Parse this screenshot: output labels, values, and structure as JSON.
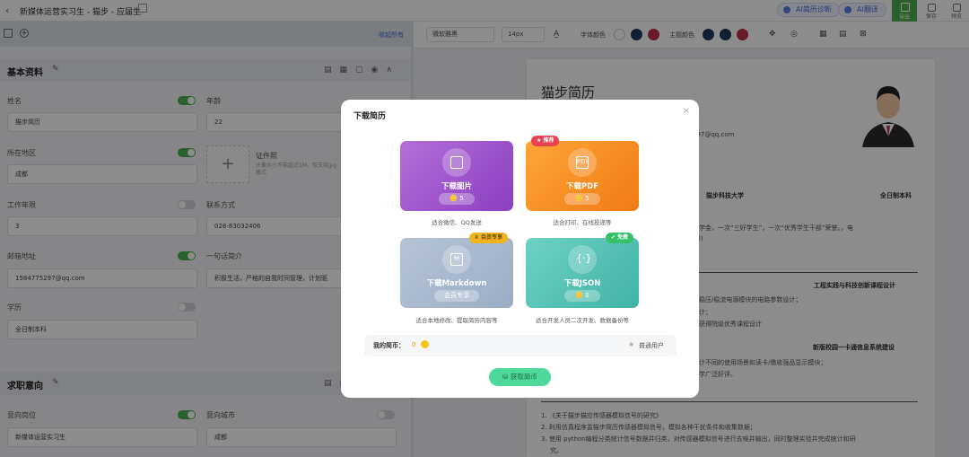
{
  "topbar": {
    "title": "新媒体运营实习生 - 猫步 - 应届生",
    "ai_diagnose": "AI简历诊断",
    "ai_translate": "AI翻译",
    "export": "导出",
    "save": "保存",
    "preview": "预览"
  },
  "left": {
    "collapse_all": "收起所有",
    "basic_section": "基本资料",
    "fields": {
      "name_label": "姓名",
      "name_value": "猫步简历",
      "age_label": "年龄",
      "age_value": "22",
      "location_label": "所在地区",
      "location_value": "成都",
      "photo_label": "证件照",
      "photo_hint": "头像大小不能超过1M，仅支持jpg格式",
      "work_years_label": "工作年限",
      "work_years_value": "3",
      "contact_label": "联系方式",
      "contact_value": "028-83032406",
      "email_label": "邮箱地址",
      "email_value": "1584775297@qq.com",
      "intro_label": "一句话简介",
      "intro_value": "积极生活，严格的自我时间管理，计划驱",
      "edu_label": "学历",
      "edu_value": "全日制本科"
    },
    "intent_section": "求职意向",
    "intent": {
      "position_label": "意向岗位",
      "position_value": "新媒体运营实习生",
      "city_label": "意向城市",
      "city_value": "成都"
    }
  },
  "toolbar": {
    "font": "微软雅黑",
    "size": "14px",
    "font_color_label": "字体颜色",
    "theme_color_label": "主题颜色"
  },
  "resume": {
    "name": "猫步简历",
    "email": "297@qq.com",
    "school": "猫步科技大学",
    "degree": "全日制本科",
    "award": "奖学金，一次“三好学生”，一次“优秀学生干部”荣誉。，电",
    "award2": "18)",
    "proj1_title": "工程实践与科技创新课程设计",
    "proj1_l1": "关稳压/稳流电源模块的电路参数设计；",
    "proj1_l2": "设计；",
    "proj1_l3": "，获得院级优秀课程设计",
    "proj2_title": "新版校园一卡通信息系统建设",
    "proj2_l1": "设计不同的使用场景和读卡/缴收强品显示模块；",
    "proj2_l2": "同学广泛好评。",
    "r1": "1. 《关于猫步猫应传感器模拟信号的研究》",
    "r2": "2. 利用仿真程序监猫步简历传感器模拟信号，模拟各种干扰条件和收集数据；",
    "r3": "3. 使用 python编程分类统计信号数据并归类，对传感器模拟信号进行去噪并输出，同时整理实验并完成统计和研",
    "r4": "究。"
  },
  "colors": {
    "font_colors": [
      "#ffffff",
      "#1f3a5f",
      "#c0304a"
    ],
    "theme_colors": [
      "#1f3a5f",
      "#1f3a5f",
      "#c0304a"
    ],
    "accent": "#4caf50"
  },
  "modal": {
    "title": "下载简历",
    "close": "×",
    "cards": [
      {
        "label": "下载图片",
        "price": "5",
        "desc": "适合微信、QQ发送",
        "badge": ""
      },
      {
        "label": "下载PDF",
        "price": "5",
        "desc": "适合打印、在线投递等",
        "badge": "推荐"
      },
      {
        "label": "下载Markdown",
        "price": "会员专享",
        "desc": "适合本地修改、提取简历内容等",
        "badge": "会员专享"
      },
      {
        "label": "下载JSON",
        "price": "0",
        "desc": "适合开发人员二次开发、数据备份等",
        "badge": "免费"
      }
    ],
    "coins_label": "我的简币：",
    "coins_value": "0",
    "user_level": "普通用户",
    "get_coins": "获取简币"
  }
}
